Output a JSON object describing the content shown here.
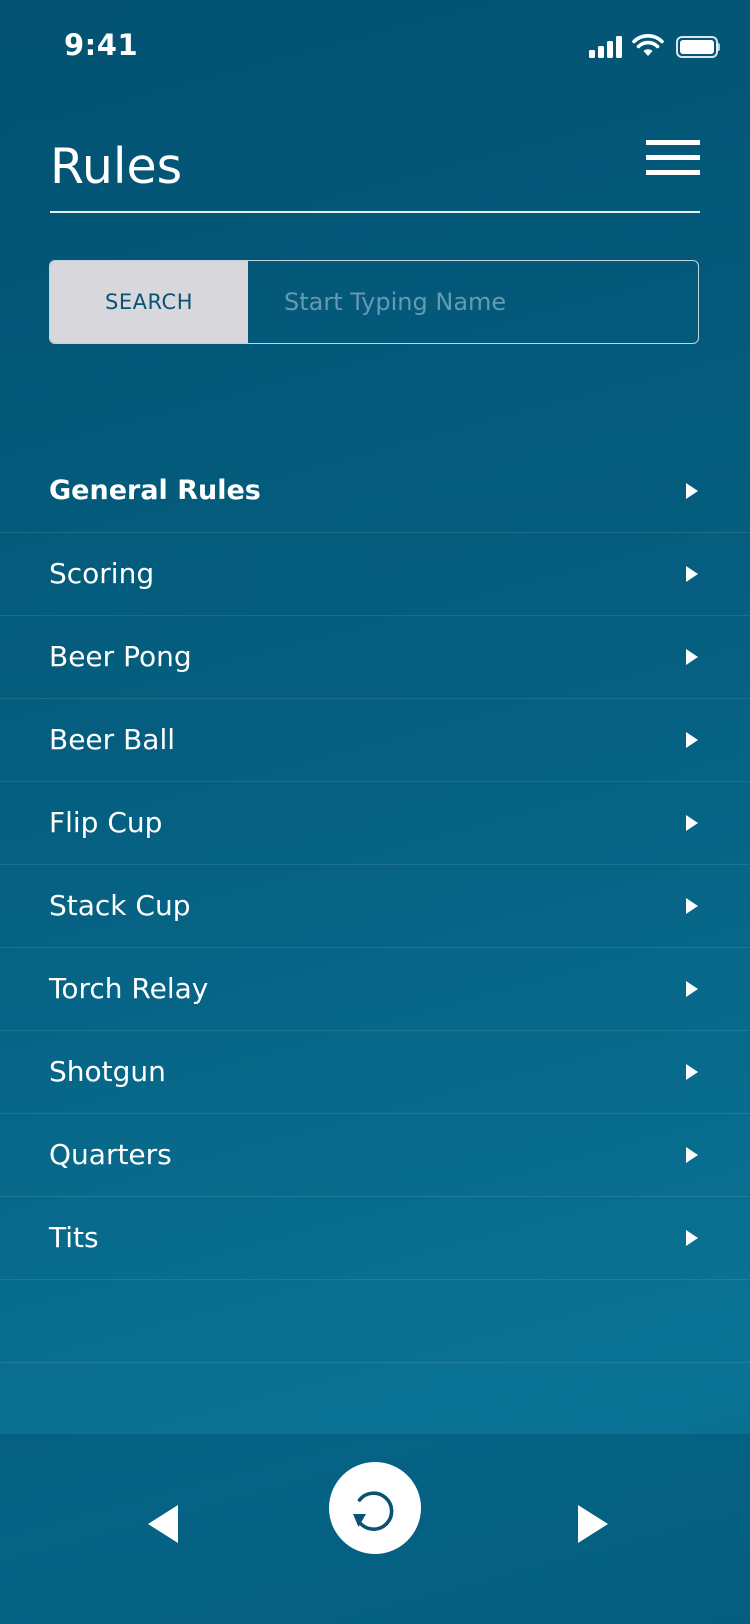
{
  "status_bar": {
    "time": "9:41",
    "icons": [
      "signal-icon",
      "wifi-icon",
      "battery-icon"
    ]
  },
  "header": {
    "title": "Rules",
    "menu_icon": "hamburger-menu-icon"
  },
  "search": {
    "button_label": "SEARCH",
    "placeholder": "Start Typing Name",
    "value": ""
  },
  "rules": {
    "items": [
      {
        "label": "General Rules"
      },
      {
        "label": "Scoring"
      },
      {
        "label": "Beer Pong"
      },
      {
        "label": "Beer Ball"
      },
      {
        "label": "Flip Cup"
      },
      {
        "label": "Stack Cup"
      },
      {
        "label": "Torch Relay"
      },
      {
        "label": "Shotgun"
      },
      {
        "label": "Quarters"
      },
      {
        "label": "Tits"
      }
    ],
    "chevron_icon": "chevron-right-icon"
  },
  "bottom_nav": {
    "prev_icon": "triangle-left-icon",
    "reset_icon": "refresh-icon",
    "next_icon": "triangle-right-icon"
  },
  "colors": {
    "background_top": "#035272",
    "background_bottom": "#0a7395",
    "search_button_bg": "#d8d8dc",
    "search_button_text": "#0a5273",
    "text": "#ffffff"
  }
}
